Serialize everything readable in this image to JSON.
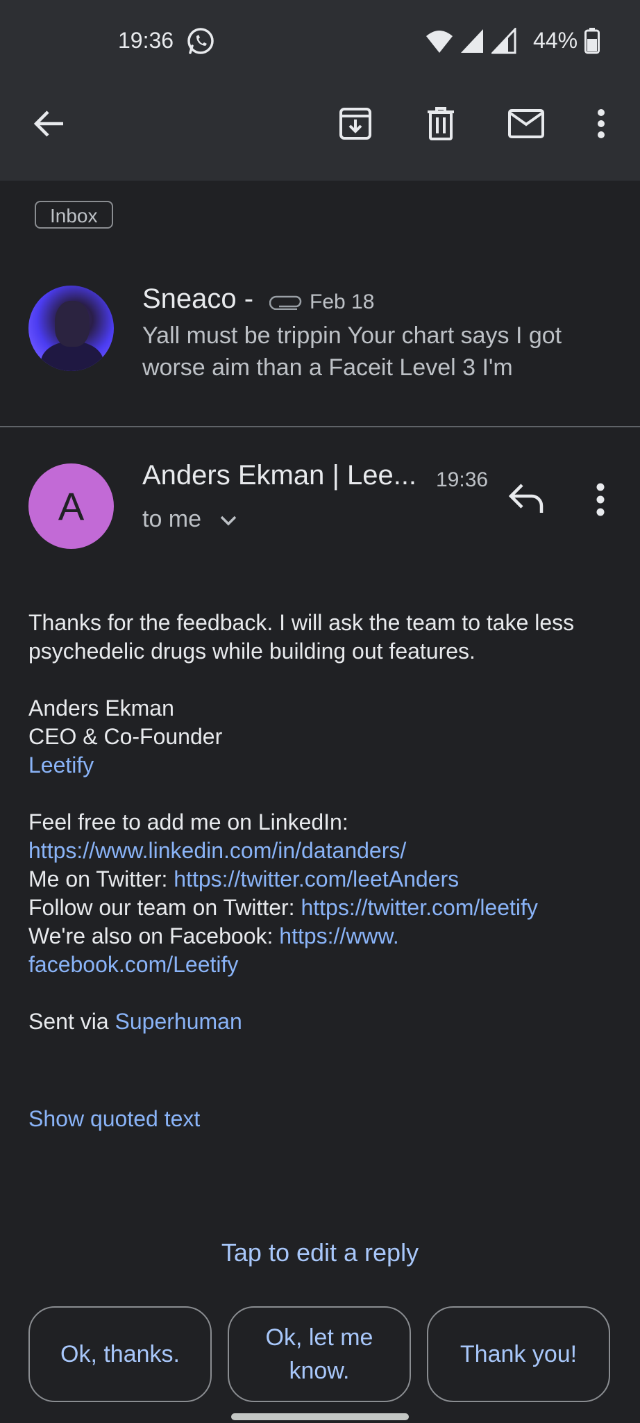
{
  "status_bar": {
    "time": "19:36",
    "battery": "44%"
  },
  "toolbar": {
    "icons": [
      "back-arrow-icon",
      "archive-icon",
      "trash-icon",
      "mail-icon",
      "more-vert-icon"
    ]
  },
  "label_chip": "Inbox",
  "previous_message": {
    "sender": "Sneaco -",
    "date": "Feb 18",
    "snippet": "Yall must be trippin Your chart says I got worse aim than a Faceit Level 3 I'm"
  },
  "message": {
    "avatar_letter": "A",
    "sender": "Anders Ekman | Lee...",
    "time": "19:36",
    "recipient": "to me",
    "body": {
      "line1": "Thanks for the feedback. I will ask the team to take less psychedelic drugs while building out features.",
      "signature_name": "Anders Ekman",
      "signature_title": "CEO & Co-Founder",
      "signature_company": "Leetify",
      "linkedin_label": "Feel free to add me on LinkedIn:",
      "linkedin_url": "https://www.linkedin.com/in/datanders/",
      "twitter_label": "Me on Twitter: ",
      "twitter_url": "https://twitter.com/leetAnders",
      "team_twitter_label": "Follow our team on Twitter: ",
      "team_twitter_url": "https://twitter.com/leetify",
      "facebook_label": "We're also on Facebook: ",
      "facebook_url_1": "https://www.",
      "facebook_url_2": "facebook.com/Leetify",
      "sent_via_label": "Sent via ",
      "sent_via_app": "Superhuman"
    },
    "show_quoted": "Show quoted text"
  },
  "reply": {
    "prompt": "Tap to edit a reply",
    "smart_replies": [
      "Ok, thanks.",
      "Ok, let me know.",
      "Thank you!"
    ]
  }
}
